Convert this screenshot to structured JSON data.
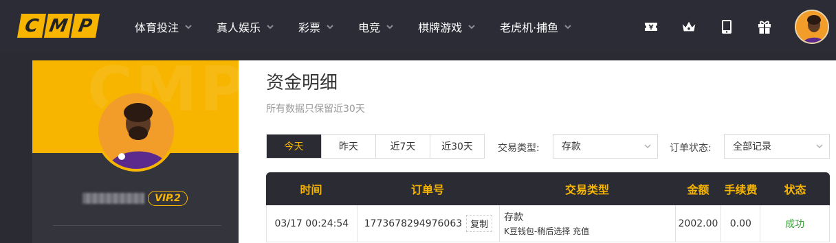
{
  "logo": {
    "letters": [
      "C",
      "M",
      "P"
    ]
  },
  "nav": {
    "items": [
      {
        "label": "体育投注"
      },
      {
        "label": "真人娱乐"
      },
      {
        "label": "彩票"
      },
      {
        "label": "电竞"
      },
      {
        "label": "棋牌游戏"
      },
      {
        "label": "老虎机·捕鱼"
      }
    ]
  },
  "tools": {
    "icons": [
      "ticket-icon",
      "crown-icon",
      "mobile-icon",
      "gift-icon"
    ]
  },
  "profile": {
    "vip": "VIP.2",
    "banner_watermark": "CMP"
  },
  "page": {
    "title": "资金明细",
    "subtitle": "所有数据只保留近30天"
  },
  "date_tabs": [
    {
      "label": "今天",
      "active": true
    },
    {
      "label": "昨天",
      "active": false
    },
    {
      "label": "近7天",
      "active": false
    },
    {
      "label": "近30天",
      "active": false
    }
  ],
  "filters": {
    "type_label": "交易类型:",
    "type_value": "存款",
    "status_label": "订单状态:",
    "status_value": "全部记录"
  },
  "table": {
    "headers": [
      "时间",
      "订单号",
      "交易类型",
      "金额",
      "手续费",
      "状态"
    ],
    "rows": [
      {
        "time": "03/17 00:24:54",
        "order_no": "1773678294976063",
        "copy_label": "复制",
        "type": "存款",
        "type_detail": "K豆钱包-稍后选择 充值",
        "amount": "2002.00",
        "fee": "0.00",
        "status": "成功"
      }
    ]
  },
  "colors": {
    "accent": "#f7b500",
    "dark": "#2a2b33",
    "success": "#3aa33a"
  }
}
